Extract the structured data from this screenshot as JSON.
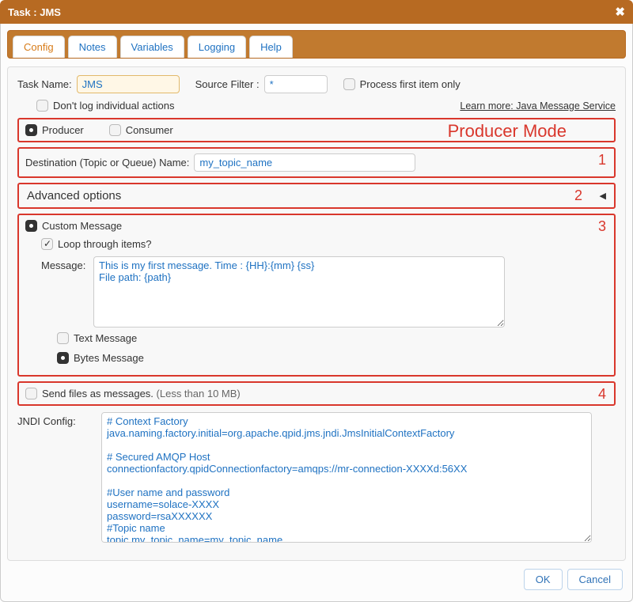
{
  "title": "Task : JMS",
  "tabs": [
    "Config",
    "Notes",
    "Variables",
    "Logging",
    "Help"
  ],
  "active_tab": 0,
  "task_name_label": "Task Name:",
  "task_name_value": "JMS",
  "source_filter_label": "Source Filter :",
  "source_filter_value": "*",
  "process_first_label": "Process first item only",
  "dont_log_label": "Don't log individual actions",
  "learn_more": "Learn more: Java Message Service",
  "mode": {
    "producer": "Producer",
    "consumer": "Consumer"
  },
  "annotations": {
    "mode": "Producer Mode",
    "n1": "1",
    "n2": "2",
    "n3": "3",
    "n4": "4"
  },
  "dest_label": "Destination (Topic or Queue) Name:",
  "dest_value": "my_topic_name",
  "adv_header": "Advanced options",
  "custom_msg_label": "Custom Message",
  "loop_label": "Loop through items?",
  "message_label": "Message:",
  "message_value": "This is my first message. Time : {HH}:{mm} {ss}\nFile path: {path}",
  "text_message_label": "Text Message",
  "bytes_message_label": "Bytes Message",
  "send_files_label": "Send files as messages. ",
  "send_files_hint": "(Less than 10 MB)",
  "jndi_label": "JNDI Config:",
  "jndi_value": "# Context Factory\njava.naming.factory.initial=org.apache.qpid.jms.jndi.JmsInitialContextFactory\n\n# Secured AMQP Host\nconnectionfactory.qpidConnectionfactory=amqps://mr-connection-XXXXd:56XX\n\n#User name and password\nusername=solace-XXXX\npassword=rsaXXXXXX\n#Topic name\ntopic.my_topic_name=my_topic_name\nqueue.my_queue=my_queue",
  "buttons": {
    "ok": "OK",
    "cancel": "Cancel"
  }
}
